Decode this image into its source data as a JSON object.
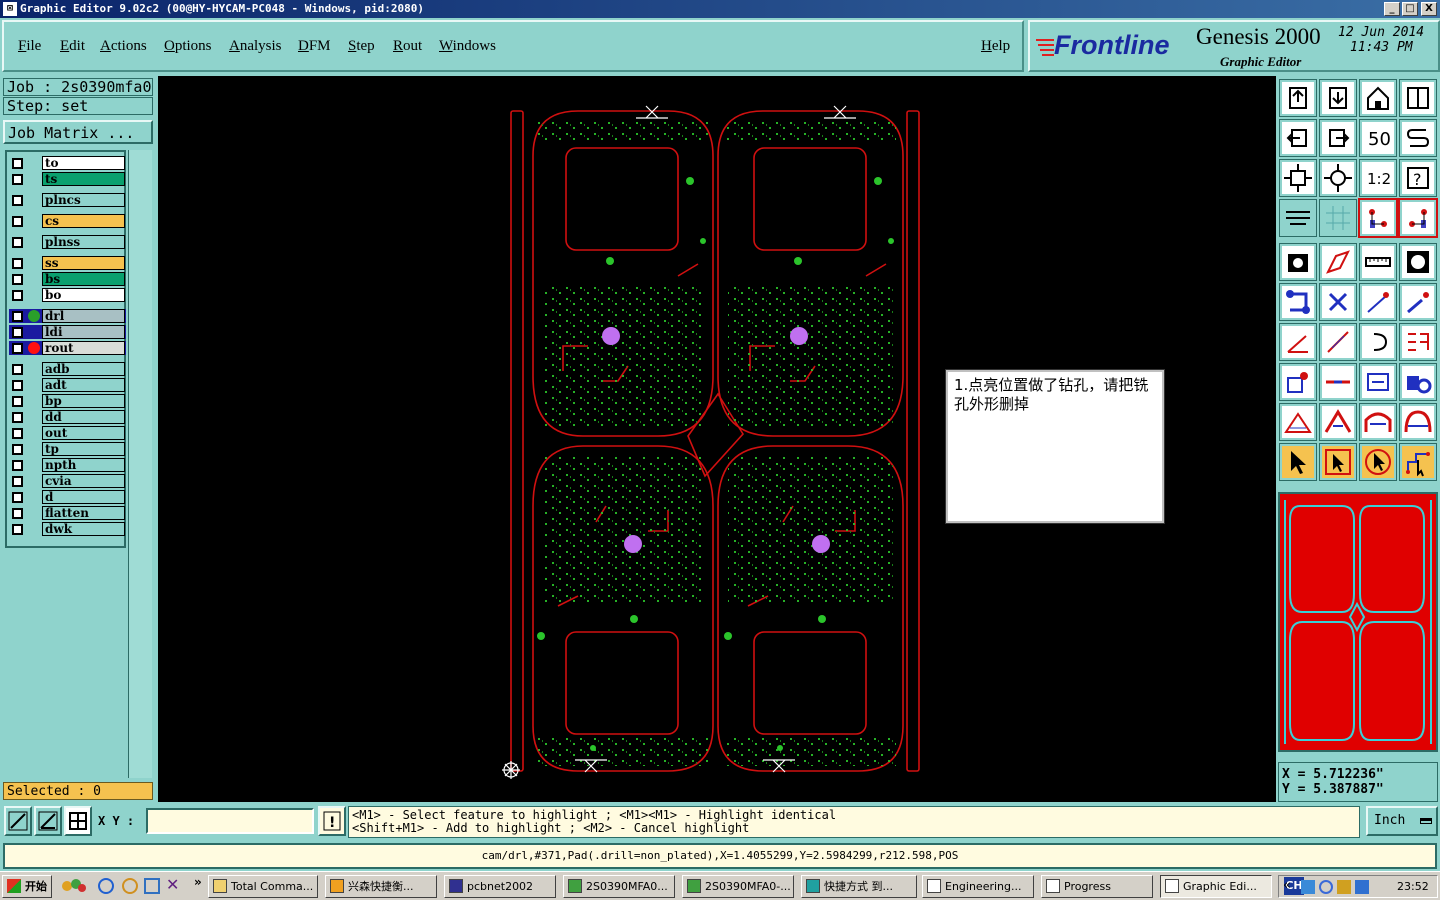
{
  "window": {
    "title": "Graphic Editor 9.02c2  (00@HY-HYCAM-PC048 - Windows, pid:2080)",
    "buttons": [
      "_",
      "□",
      "X"
    ]
  },
  "menu": [
    "File",
    "Edit",
    "Actions",
    "Options",
    "Analysis",
    "DFM",
    "Step",
    "Rout",
    "Windows"
  ],
  "help_label": "Help",
  "logo": {
    "brand": "Frontline",
    "product": "Genesis 2000",
    "subtitle": "Graphic Editor",
    "date": "12  Jun  2014",
    "time": "11:43  PM"
  },
  "left": {
    "job": "Job : 2s0390mfa0",
    "step": "Step: set",
    "job_matrix": "Job Matrix ...",
    "selected": "Selected : 0"
  },
  "layers": [
    {
      "name": "to",
      "color": "#ffffff"
    },
    {
      "name": "ts",
      "color": "#0aa06e"
    },
    {
      "name": "plncs",
      "color": "#8fd3cc"
    },
    {
      "name": "cs",
      "color": "#f5c24f"
    },
    {
      "name": "plnss",
      "color": "#8fd3cc"
    },
    {
      "name": "ss",
      "color": "#f5c24f"
    },
    {
      "name": "bs",
      "color": "#0aa06e"
    },
    {
      "name": "bo",
      "color": "#ffffff"
    },
    {
      "name": "drl",
      "color": "#a8c0c4",
      "marker": "#2aa02a"
    },
    {
      "name": "ldi",
      "color": "#a8c0c4"
    },
    {
      "name": "rout",
      "color": "#d9ddd8",
      "marker": "#ff1010"
    },
    {
      "name": "adb",
      "color": "#8fd3cc"
    },
    {
      "name": "adt",
      "color": "#8fd3cc"
    },
    {
      "name": "bp",
      "color": "#8fd3cc"
    },
    {
      "name": "dd",
      "color": "#8fd3cc"
    },
    {
      "name": "out",
      "color": "#8fd3cc"
    },
    {
      "name": "tp",
      "color": "#8fd3cc"
    },
    {
      "name": "npth",
      "color": "#8fd3cc"
    },
    {
      "name": "cvia",
      "color": "#8fd3cc"
    },
    {
      "name": "d",
      "color": "#8fd3cc"
    },
    {
      "name": "flatten",
      "color": "#8fd3cc"
    },
    {
      "name": "dwk",
      "color": "#8fd3cc"
    }
  ],
  "note": "1.点亮位置做了钻孔，请把铣孔外形删掉",
  "coords": {
    "x": "X = 5.712236\"",
    "y": "Y = 5.387887\""
  },
  "zoom_label": "1:2",
  "bottom": {
    "xy_label": "X Y :",
    "xy_value": "",
    "hint_line1": "<M1> - Select feature to highlight ; <M1><M1> - Highlight identical",
    "hint_line2": "<Shift+M1> - Add to highlight ; <M2> - Cancel highlight",
    "unit": "Inch",
    "status": "cam/drl,#371,Pad(.drill=non_plated),X=1.4055299,Y=2.5984299,r212.598,POS"
  },
  "taskbar": {
    "start": "开始",
    "tasks": [
      "Total Comma...",
      "兴森快捷衡...",
      "pcbnet2002",
      "2S0390MFA0...",
      "2S0390MFA0-...",
      "快捷方式 到...",
      "Engineering...",
      "Progress",
      "Graphic Edi..."
    ],
    "lang": "CH",
    "clock": "23:52"
  },
  "colors": {
    "panel": "#8fd3cc",
    "rout": "#d01010",
    "pads": "#2bc42b",
    "highlight": "#c070f0"
  }
}
